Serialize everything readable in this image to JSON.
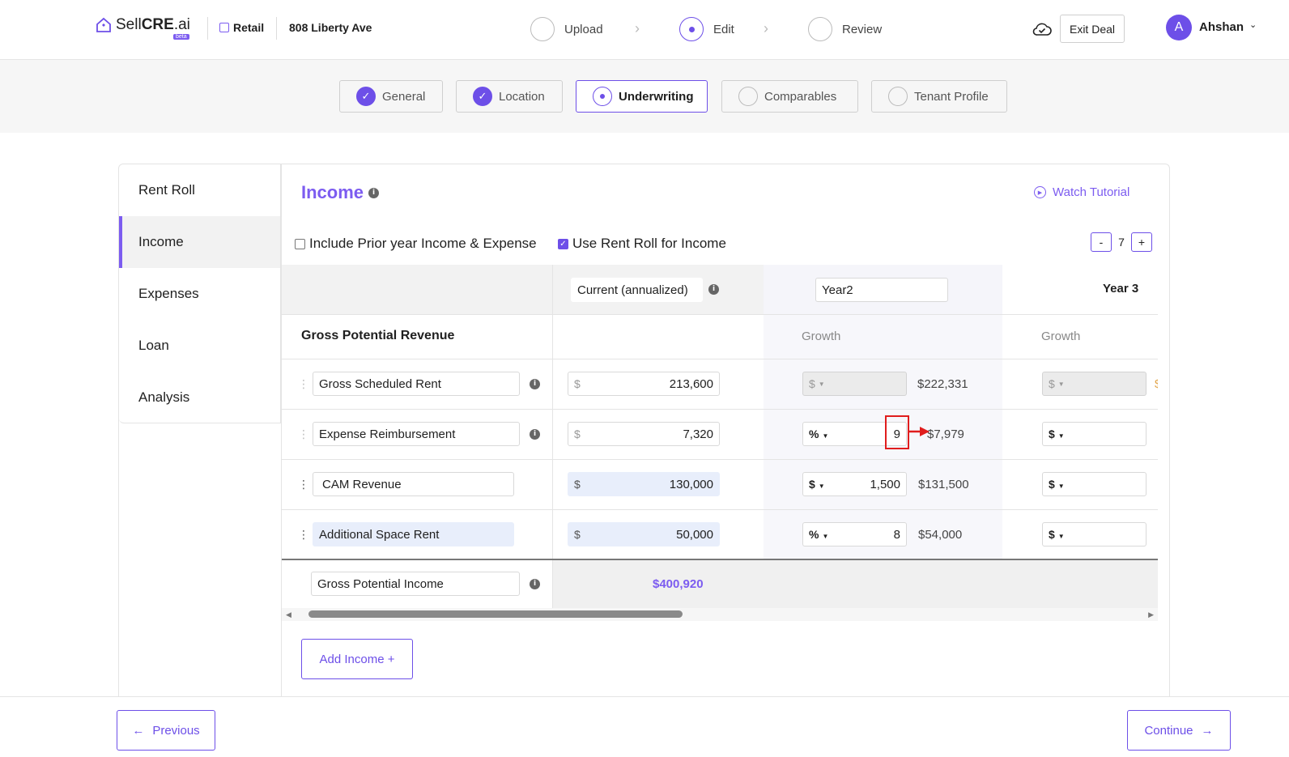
{
  "app": {
    "brand_pre": "Sell",
    "brand_bold": "CRE",
    "brand_post": ".ai",
    "badge": "beta",
    "property_type": "Retail",
    "address": "808 Liberty Ave"
  },
  "steps": [
    {
      "label": "Upload",
      "state": "pending"
    },
    {
      "label": "Edit",
      "state": "active"
    },
    {
      "label": "Review",
      "state": "pending"
    }
  ],
  "header": {
    "exit_label": "Exit Deal",
    "avatar_initial": "A",
    "user_name": "Ahshan"
  },
  "tabs": [
    {
      "label": "General",
      "state": "done"
    },
    {
      "label": "Location",
      "state": "done"
    },
    {
      "label": "Underwriting",
      "state": "active"
    },
    {
      "label": "Comparables",
      "state": "pending"
    },
    {
      "label": "Tenant Profile",
      "state": "pending"
    }
  ],
  "sidenav": [
    "Rent Roll",
    "Income",
    "Expenses",
    "Loan",
    "Analysis"
  ],
  "sidenav_active": "Income",
  "income": {
    "title": "Income",
    "watch_label": "Watch Tutorial",
    "opt_prior": "Include Prior year Income & Expense",
    "opt_prior_checked": false,
    "opt_rentroll": "Use Rent Roll for Income",
    "opt_rentroll_checked": true,
    "years_minus": "-",
    "years_value": "7",
    "years_plus": "+"
  },
  "table": {
    "col_current": "Current (annualized)",
    "col_year2": "Year2",
    "col_year3": "Year 3",
    "section": "Gross Potential Revenue",
    "growth_label": "Growth",
    "currency": "$",
    "rows": [
      {
        "name": "Gross Scheduled Rent",
        "current": "213,600",
        "g_unit": "$",
        "g_value": "",
        "y2": "$222,331",
        "y3_unit": "$",
        "y3_trunc": "$"
      },
      {
        "name": "Expense Reimbursement",
        "current": "7,320",
        "g_unit": "%",
        "g_value": "9",
        "y2": "$7,979",
        "y3_unit": "$",
        "y3_trunc": ""
      },
      {
        "name": "CAM Revenue",
        "current": "130,000",
        "g_unit": "$",
        "g_value": "1,500",
        "y2": "$131,500",
        "y3_unit": "$",
        "y3_trunc": ""
      },
      {
        "name": "Additional Space Rent",
        "current": "50,000",
        "g_unit": "%",
        "g_value": "8",
        "y2": "$54,000",
        "y3_unit": "$",
        "y3_trunc": ""
      }
    ],
    "total_label": "Gross Potential Income",
    "total_value": "$400,920"
  },
  "actions": {
    "add_income": "Add Income +",
    "previous": "Previous",
    "continue": "Continue"
  },
  "colors": {
    "accent": "#6d4fe8",
    "accent_text": "#7c5cf0",
    "annotation": "#e01d1d"
  }
}
